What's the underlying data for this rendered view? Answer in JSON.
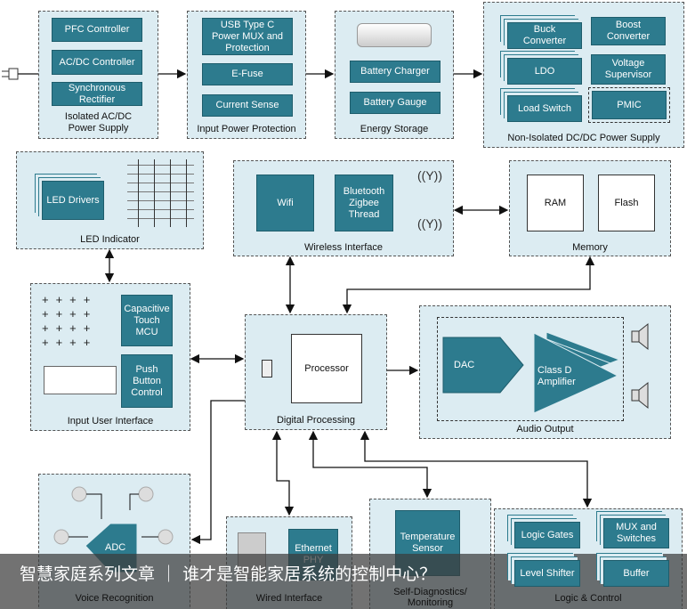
{
  "isolated": {
    "title": "Isolated AC/DC Power Supply",
    "blocks": [
      "PFC Controller",
      "AC/DC Controller",
      "Synchronous Rectifier"
    ]
  },
  "input_power": {
    "title": "Input Power Protection",
    "blocks": [
      "USB Type C Power MUX and Protection",
      "E-Fuse",
      "Current Sense"
    ]
  },
  "energy": {
    "title": "Energy Storage",
    "blocks": [
      "Battery Charger",
      "Battery Gauge"
    ]
  },
  "nonisolated": {
    "title": "Non-Isolated DC/DC Power Supply",
    "blocks": [
      "Buck Converter",
      "Boost Converter",
      "LDO",
      "Voltage Supervisor",
      "Load Switch",
      "PMIC"
    ]
  },
  "led": {
    "title": "LED Indicator",
    "blocks": [
      "LED Drivers"
    ]
  },
  "wireless": {
    "title": "Wireless Interface",
    "blocks": [
      "Wifi",
      "Bluetooth Zigbee Thread"
    ]
  },
  "memory": {
    "title": "Memory",
    "blocks": [
      "RAM",
      "Flash"
    ]
  },
  "input_ui": {
    "title": "Input User Interface",
    "blocks": [
      "Capacitive Touch MCU",
      "Push Button Control"
    ]
  },
  "digital": {
    "title": "Digital Processing",
    "blocks": [
      "Processor"
    ]
  },
  "audio": {
    "title": "Audio Output",
    "blocks": [
      "DAC",
      "Class D Amplifier"
    ]
  },
  "voice": {
    "title": "Voice Recognition",
    "blocks": [
      "ADC"
    ]
  },
  "wired": {
    "title": "Wired Interface",
    "blocks": [
      "Ethernet PHY"
    ]
  },
  "diag": {
    "title": "Self-Diagnostics/ Monitoring",
    "blocks": [
      "Temperature Sensor"
    ]
  },
  "logic": {
    "title": "Logic & Control",
    "blocks": [
      "Logic Gates",
      "MUX and Switches",
      "Level Shifter",
      "Buffer"
    ]
  },
  "caption": "智慧家庭系列文章 ｜ 谁才是智能家居系统的控制中心？",
  "colors": {
    "panel": "#dcecf2",
    "block": "#2d7b8e"
  }
}
